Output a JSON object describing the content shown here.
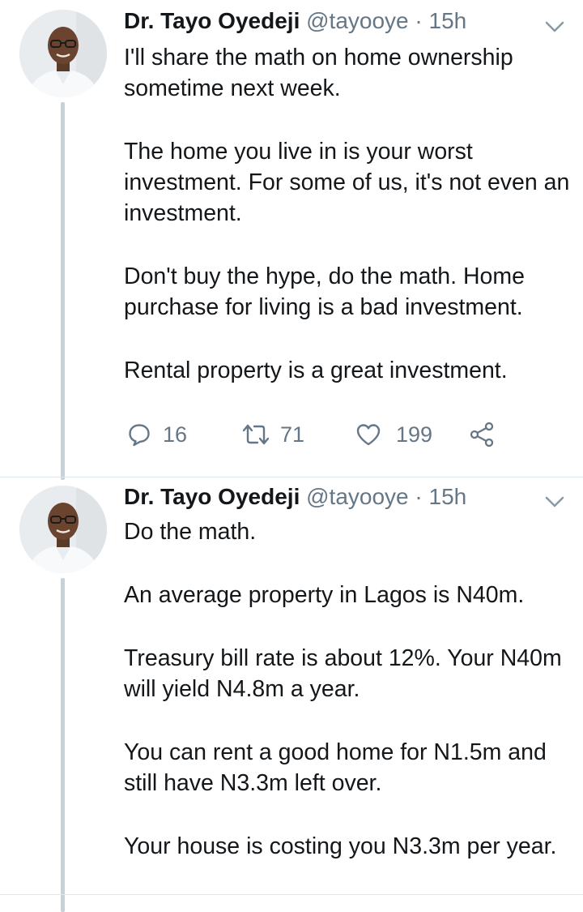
{
  "tweets": [
    {
      "author_name": "Dr. Tayo Oyedeji",
      "handle": "@tayooye",
      "separator": "·",
      "time": "15h",
      "paragraphs": [
        "I'll share the math on home ownership sometime next week.",
        "The home you live in is your worst investment. For some of us, it's not even an investment.",
        "Don't buy the hype, do the math. Home purchase for living  is a bad investment.",
        "Rental property is a great investment."
      ],
      "actions": {
        "replies": "16",
        "retweets": "71",
        "likes": "199"
      }
    },
    {
      "author_name": "Dr. Tayo Oyedeji",
      "handle": "@tayooye",
      "separator": "·",
      "time": "15h",
      "paragraphs": [
        "Do the math.",
        "An average property in Lagos is N40m.",
        "Treasury bill rate is about 12%. Your N40m will yield N4.8m a year.",
        "You can rent a good home for N1.5m and still have N3.3m left over.",
        "Your house is costing you N3.3m per year."
      ]
    }
  ],
  "icons": {
    "reply": "reply-icon",
    "retweet": "retweet-icon",
    "like": "heart-icon",
    "share": "share-icon",
    "more": "chevron-down-icon"
  },
  "colors": {
    "text": "#14171a",
    "muted": "#657786",
    "thread_line": "#c7d1d8",
    "divider": "#e1e8ed"
  }
}
